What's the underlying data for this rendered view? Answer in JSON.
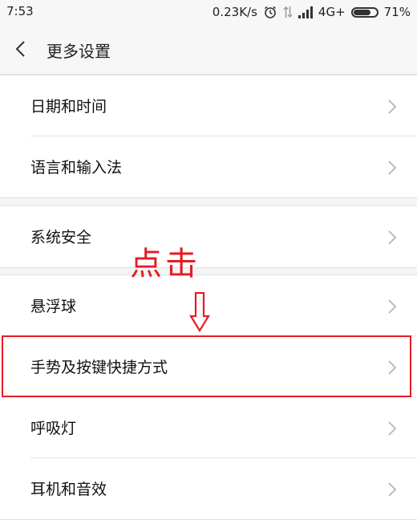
{
  "status_bar": {
    "time": "7:53",
    "net_speed": "0.23K/s",
    "network": "4G+",
    "battery_text": "71%",
    "battery_level": 0.71
  },
  "header": {
    "title": "更多设置"
  },
  "sections": [
    {
      "items": [
        "日期和时间",
        "语言和输入法"
      ]
    },
    {
      "items": [
        "系统安全"
      ]
    },
    {
      "items": [
        "悬浮球",
        "手势及按键快捷方式",
        "呼吸灯",
        "耳机和音效"
      ]
    }
  ],
  "annotation": {
    "text": "点击",
    "color": "#e51c23"
  },
  "icons": {
    "back": "chevron-left-icon",
    "item_arrow": "chevron-right-icon",
    "alarm": "alarm-icon",
    "data": "data-transfer-icon",
    "signal": "signal-icon",
    "battery": "battery-icon"
  }
}
